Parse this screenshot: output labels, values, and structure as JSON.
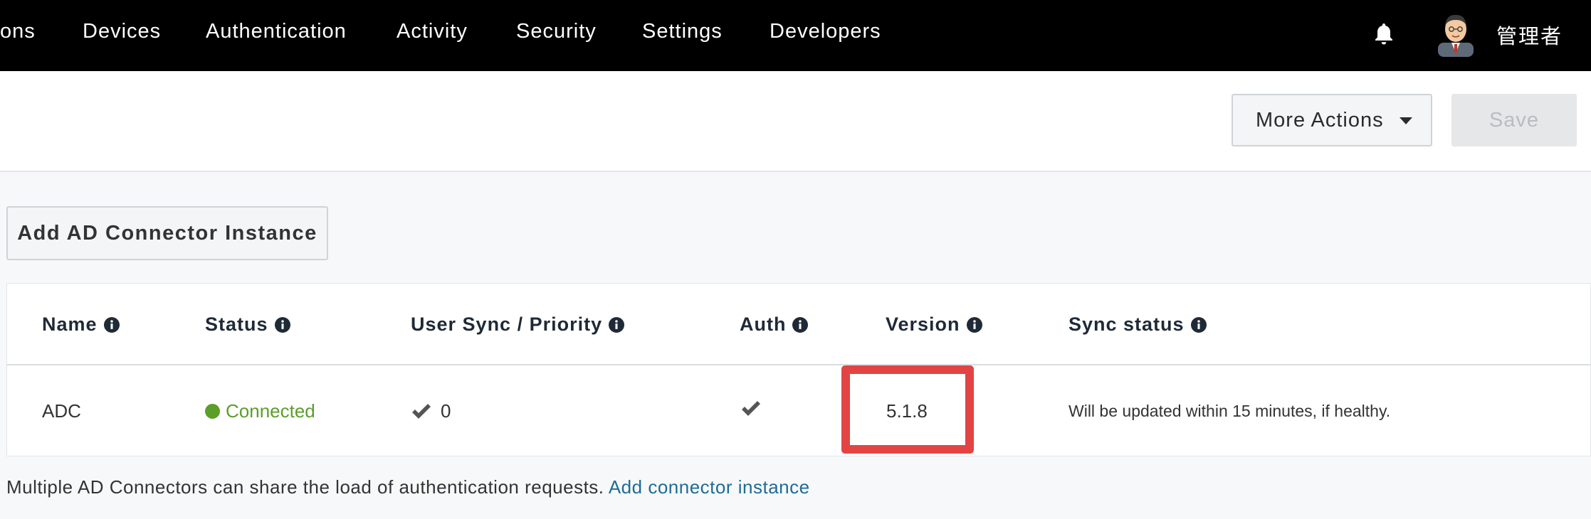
{
  "nav": {
    "items": [
      "ons",
      "Devices",
      "Authentication",
      "Activity",
      "Security",
      "Settings",
      "Developers"
    ],
    "user_name": "管理者"
  },
  "actions": {
    "more_actions": "More Actions",
    "save": "Save"
  },
  "add_instance_button": "Add AD Connector Instance",
  "table": {
    "headers": [
      "Name",
      "Status",
      "User Sync / Priority",
      "Auth",
      "Version",
      "Sync status"
    ],
    "rows": [
      {
        "name": "ADC",
        "status": "Connected",
        "user_sync_priority": "0",
        "version": "5.1.8",
        "sync_status": "Will be updated within 15 minutes, if healthy."
      }
    ]
  },
  "footer": {
    "text": "Multiple AD Connectors can share the load of authentication requests.",
    "link": "Add connector instance"
  },
  "colors": {
    "nav_bg": "#000000",
    "status_green": "#5b9e2a",
    "link_blue": "#1f6b95",
    "highlight_red": "#e24444"
  }
}
